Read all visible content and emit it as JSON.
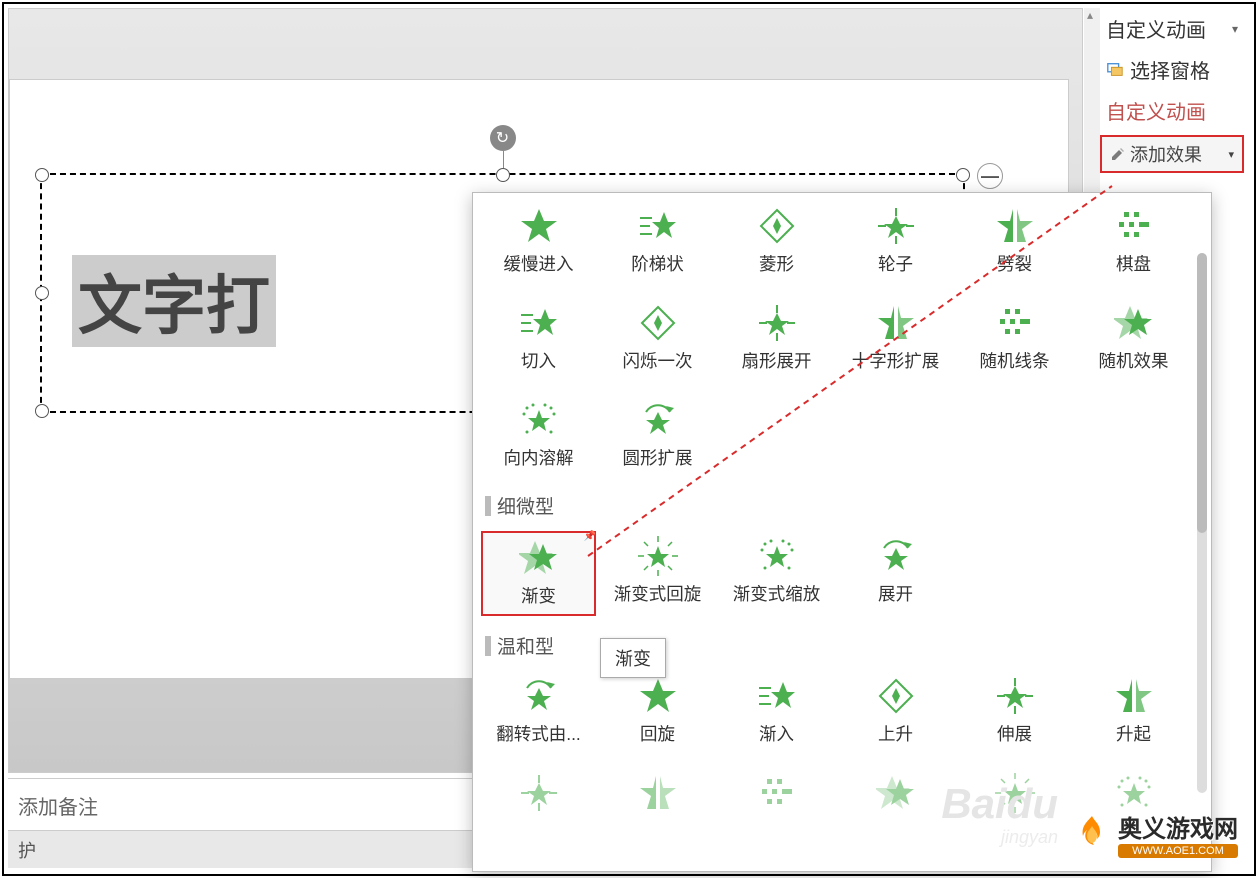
{
  "sidebar": {
    "custom_animation_menu": "自定义动画",
    "select_pane": "选择窗格",
    "custom_animation_link": "自定义动画",
    "add_effect": "添加效果"
  },
  "slide": {
    "text": "文字打",
    "notes_placeholder": "添加备注",
    "status_left": "护"
  },
  "tooltip": {
    "text": "渐变"
  },
  "sections": {
    "subtle": "细微型",
    "moderate": "温和型"
  },
  "effects": {
    "row1": [
      {
        "label": "缓慢进入"
      },
      {
        "label": "阶梯状"
      },
      {
        "label": "菱形"
      },
      {
        "label": "轮子"
      },
      {
        "label": "劈裂"
      },
      {
        "label": "棋盘"
      }
    ],
    "row2": [
      {
        "label": "切入"
      },
      {
        "label": "闪烁一次"
      },
      {
        "label": "扇形展开"
      },
      {
        "label": "十字形扩展"
      },
      {
        "label": "随机线条"
      },
      {
        "label": "随机效果"
      }
    ],
    "row3": [
      {
        "label": "向内溶解"
      },
      {
        "label": "圆形扩展"
      }
    ],
    "subtle": [
      {
        "label": "渐变",
        "highlighted": true
      },
      {
        "label": "渐变式回旋"
      },
      {
        "label": "渐变式缩放"
      },
      {
        "label": "展开"
      }
    ],
    "moderate": [
      {
        "label": "翻转式由..."
      },
      {
        "label": "回旋"
      },
      {
        "label": "渐入"
      },
      {
        "label": "上升"
      },
      {
        "label": "伸展"
      },
      {
        "label": "升起"
      }
    ]
  },
  "colors": {
    "accent_red": "#d92b2b",
    "star_green": "#4caf50",
    "link_orange": "#c0504d"
  },
  "watermark": {
    "main": "奥义游戏网",
    "url": "WWW.AOE1.COM",
    "baidu": "Baidu",
    "baidu_sub": "jingyan"
  }
}
